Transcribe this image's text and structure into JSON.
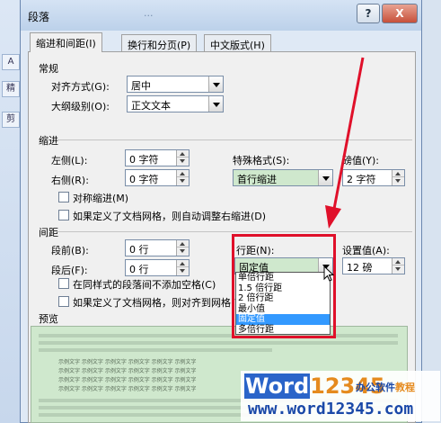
{
  "window": {
    "title": "段落",
    "help_label": "?",
    "close_label": "X",
    "bg_title": "...",
    "bg_side": [
      "A",
      "精",
      "剪"
    ]
  },
  "tabs": [
    {
      "label": "缩进和间距(I)",
      "active": true
    },
    {
      "label": "换行和分页(P)",
      "active": false
    },
    {
      "label": "中文版式(H)",
      "active": false
    }
  ],
  "general": {
    "section": "常规",
    "alignment_label": "对齐方式(G):",
    "alignment_value": "居中",
    "outline_label": "大纲级别(O):",
    "outline_value": "正文文本"
  },
  "indent": {
    "section": "缩进",
    "left_label": "左侧(L):",
    "left_value": "0 字符",
    "right_label": "右侧(R):",
    "right_value": "0 字符",
    "special_label": "特殊格式(S):",
    "special_value": "首行缩进",
    "by_label": "磅值(Y):",
    "by_value": "2 字符",
    "mirror_label": "对称缩进(M)",
    "auto_label": "如果定义了文档网格，则自动调整右缩进(D)"
  },
  "spacing": {
    "section": "间距",
    "before_label": "段前(B):",
    "before_value": "0 行",
    "after_label": "段后(F):",
    "after_value": "0 行",
    "line_label": "行距(N):",
    "line_value": "固定值",
    "at_label": "设置值(A):",
    "at_value": "12 磅",
    "no_space_label": "在同样式的段落间不添加空格(C)",
    "snap_label": "如果定义了文档网格，则对齐到网格(W)"
  },
  "line_spacing_options": [
    "单倍行距",
    "1.5 倍行距",
    "2 倍行距",
    "最小值",
    "固定值",
    "多倍行距"
  ],
  "line_spacing_selected": 4,
  "preview": {
    "section": "预览",
    "sample_text": "示例文字 示例文字 示例文字 示例文字 示例文字 示例文字"
  },
  "watermark": {
    "word": "Word",
    "num": "12345",
    "cn_a": "办公软件",
    "cn_b": "教程",
    "url": "www.word12345.com"
  },
  "colors": {
    "highlight_red": "#e0102a",
    "selection_blue": "#3399ff",
    "preview_green": "#cfe8cd"
  }
}
